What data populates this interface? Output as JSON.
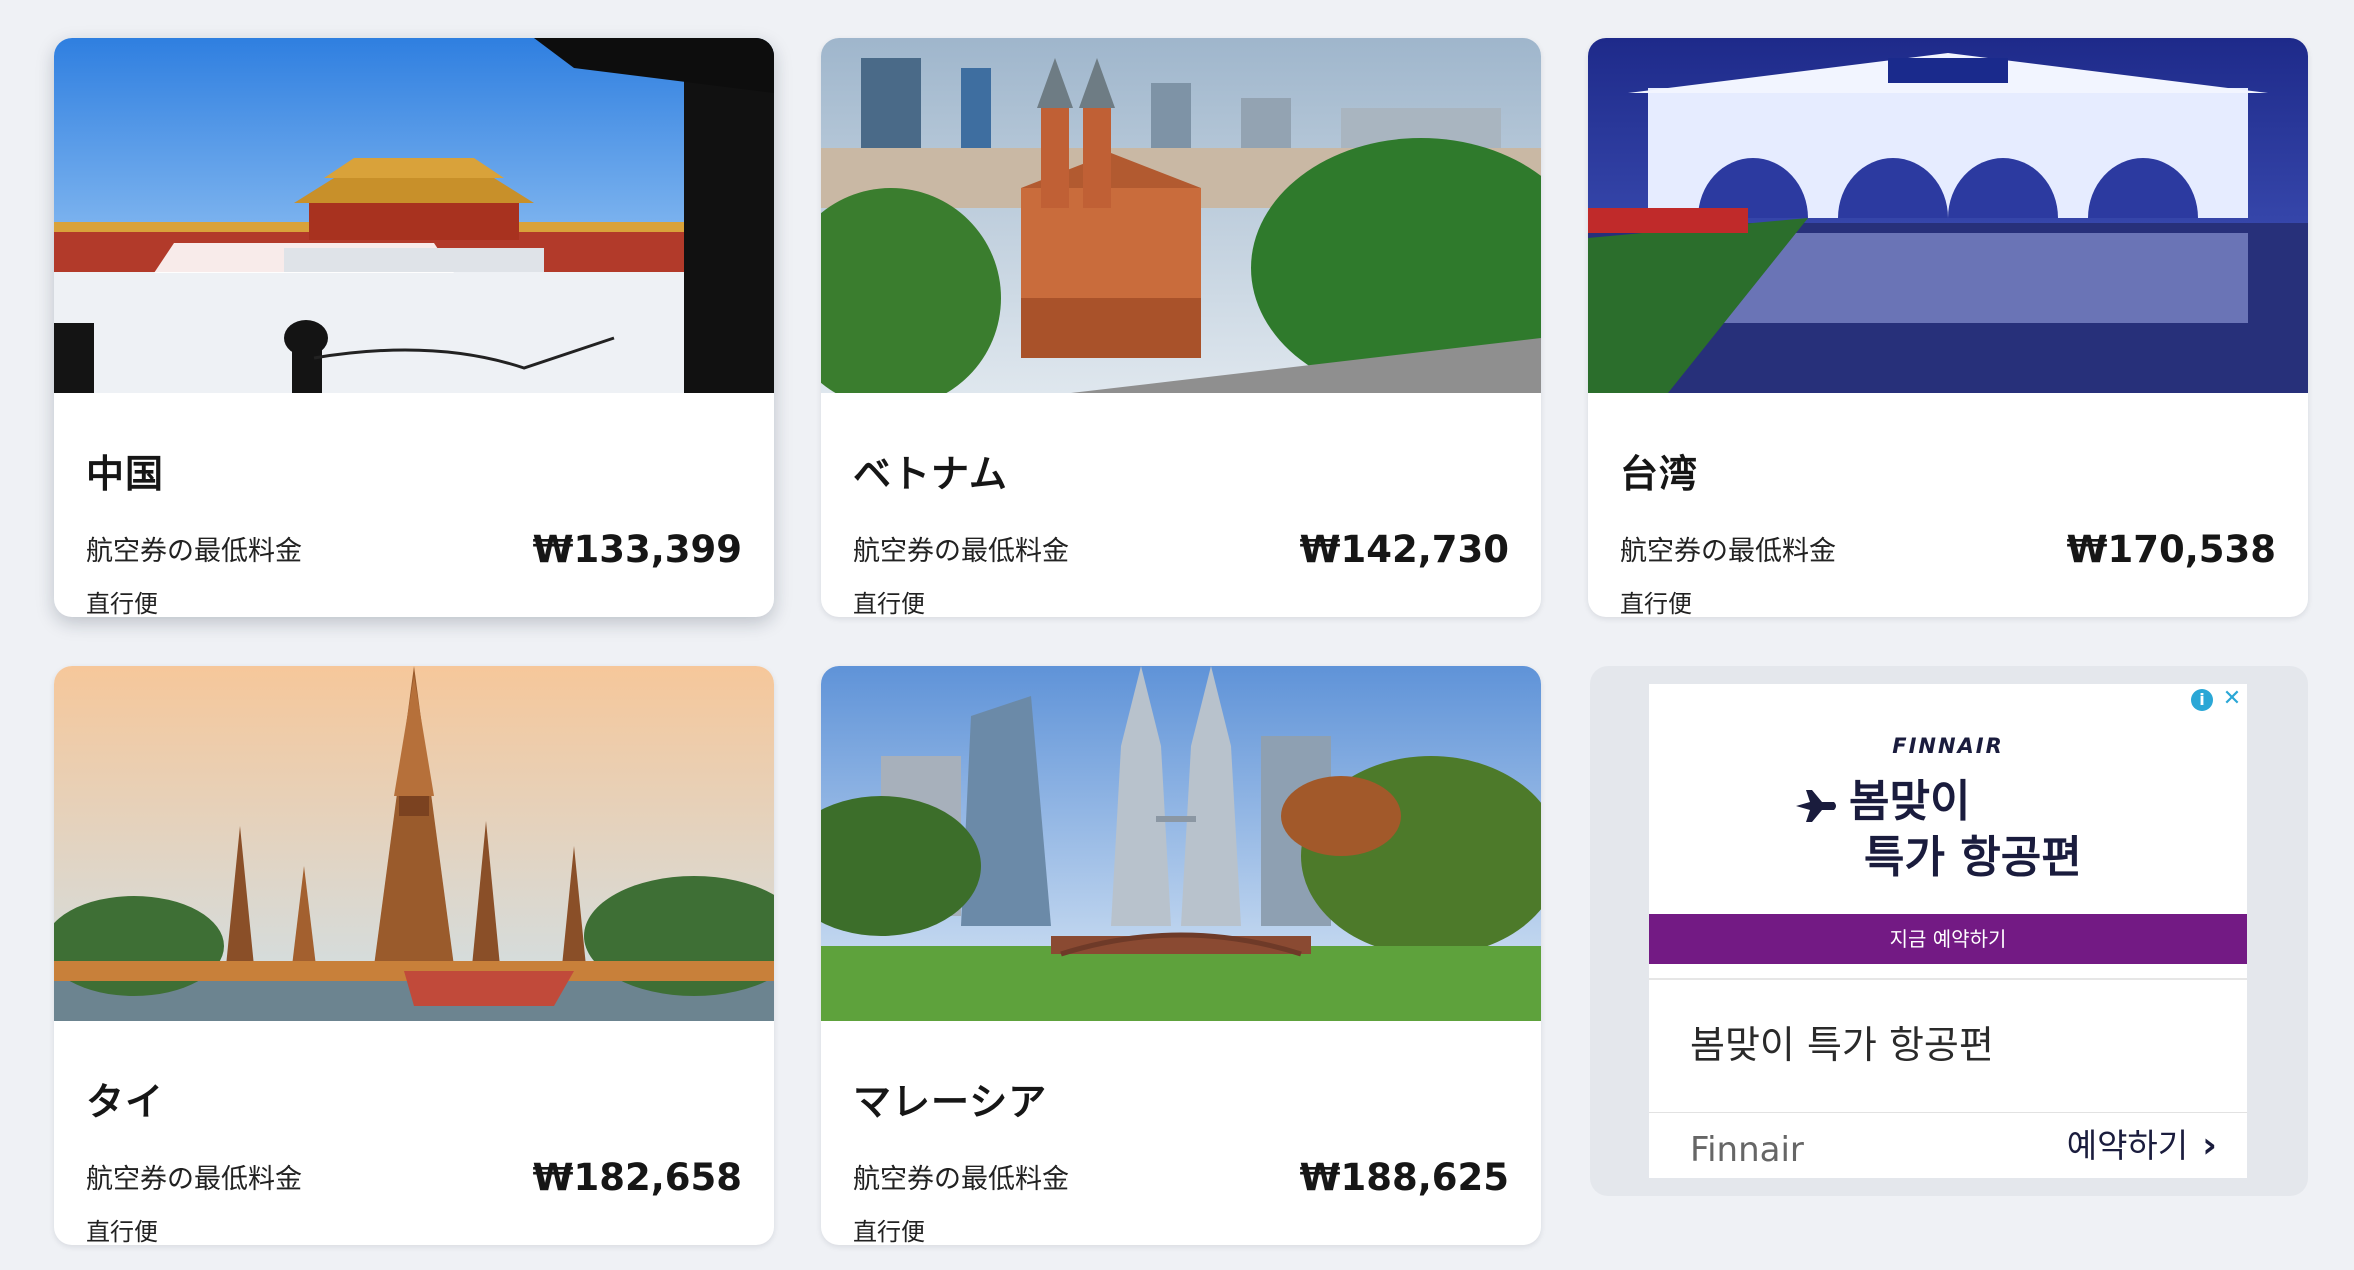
{
  "destinations": [
    {
      "name": "中国",
      "label": "航空券の最低料金",
      "price": "₩133,399",
      "tag": "直行便",
      "photo": "forbidden-city-photo"
    },
    {
      "name": "ベトナム",
      "label": "航空券の最低料金",
      "price": "₩142,730",
      "tag": "直行便",
      "photo": "saigon-cathedral-photo"
    },
    {
      "name": "台湾",
      "label": "航空券の最低料金",
      "price": "₩170,538",
      "tag": "直行便",
      "photo": "taipei-gate-photo"
    },
    {
      "name": "タイ",
      "label": "航空券の最低料金",
      "price": "₩182,658",
      "tag": "直行便",
      "photo": "wat-arun-photo"
    },
    {
      "name": "マレーシア",
      "label": "航空券の最低料金",
      "price": "₩188,625",
      "tag": "直行便",
      "photo": "petronas-towers-photo"
    }
  ],
  "ad": {
    "brand": "FINNAIR",
    "headline_line1": "봄맞이",
    "headline_line2": "특가 항공편",
    "cta": "지금 예약하기",
    "title": "봄맞이 특가 항공편",
    "advertiser": "Finnair",
    "link_label": "예약하기",
    "info_icon": "i",
    "close_icon": "✕",
    "chevron": "›"
  },
  "colors": {
    "page_bg": "#eff1f5",
    "card_bg": "#ffffff",
    "ad_purple": "#731a84",
    "ad_navy": "#1a1c3d",
    "ad_control": "#2aa7d6"
  }
}
